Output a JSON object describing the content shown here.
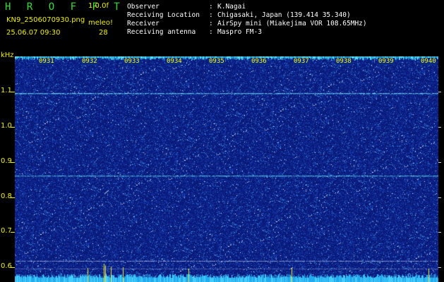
{
  "header": {
    "brand": "H R O F F T",
    "version": "1.0.0f",
    "filename": "KN9_2506070930.png",
    "datetime": "25.06.07 09:30",
    "meleo_label": "meleo!",
    "meleo_count": "28"
  },
  "info": [
    {
      "label": "Observer",
      "value": "K.Nagai"
    },
    {
      "label": "Receiving Location",
      "value": "Chigasaki, Japan (139.414 35.340)"
    },
    {
      "label": "Receiver",
      "value": "AirSpy mini (Miakejima VOR 108.65MHz)"
    },
    {
      "label": "Receiving antenna",
      "value": "Maspro FM-3"
    }
  ],
  "axis": {
    "unit": "kHz",
    "freq_labels": [
      "1.1",
      "1.0",
      "0.9",
      "0.8",
      "0.7",
      "0.6"
    ],
    "time_labels": [
      "0931",
      "0932",
      "0933",
      "0934",
      "0935",
      "0936",
      "0937",
      "0938",
      "0939",
      "0940"
    ]
  },
  "colors": {
    "background": "#0d1a7a",
    "signal": "#66ddff",
    "label": "#f0f000",
    "brand": "#33e033"
  }
}
